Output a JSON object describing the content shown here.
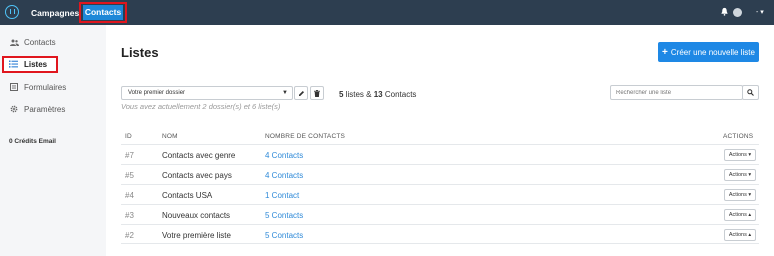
{
  "topbar": {
    "logo_icon": "hexagon-logo-icon",
    "nav": [
      {
        "label": "Campagnes"
      },
      {
        "label": "Contacts",
        "active": true
      }
    ],
    "user_menu": "-"
  },
  "sidebar": {
    "items": [
      {
        "label": "Contacts",
        "icon": "users-icon"
      },
      {
        "label": "Listes",
        "icon": "list-icon",
        "active": true
      },
      {
        "label": "Formulaires",
        "icon": "form-icon"
      },
      {
        "label": "Paramètres",
        "icon": "gear-icon"
      }
    ],
    "credits": "0 Crédits Email"
  },
  "main": {
    "title": "Listes",
    "create_button": "Créer une nouvelle liste",
    "folder_select": "Votre premier dossier",
    "summary": {
      "lists": "5",
      "lists_label": "listes &",
      "contacts": "13",
      "contacts_label": "Contacts"
    },
    "hint": "Vous avez actuellement 2 dossier(s) et 6 liste(s)",
    "search_placeholder": "Rechercher une liste",
    "columns": {
      "id": "ID",
      "name": "NOM",
      "count": "NOMBRE DE CONTACTS",
      "actions": "ACTIONS"
    },
    "rows": [
      {
        "id": "#7",
        "name": "Contacts avec genre",
        "count": "4 Contacts",
        "actions": "Actions ▾"
      },
      {
        "id": "#5",
        "name": "Contacts avec pays",
        "count": "4 Contacts",
        "actions": "Actions ▾"
      },
      {
        "id": "#4",
        "name": "Contacts USA",
        "count": "1 Contact",
        "actions": "Actions ▾"
      },
      {
        "id": "#3",
        "name": "Nouveaux contacts",
        "count": "5 Contacts",
        "actions": "Actions ▴"
      },
      {
        "id": "#2",
        "name": "Votre première liste",
        "count": "5 Contacts",
        "actions": "Actions ▴"
      }
    ]
  },
  "colors": {
    "topbar": "#2d3e50",
    "accent": "#1e88e5",
    "link": "#2f8ad8",
    "highlight": "#e0161e"
  }
}
